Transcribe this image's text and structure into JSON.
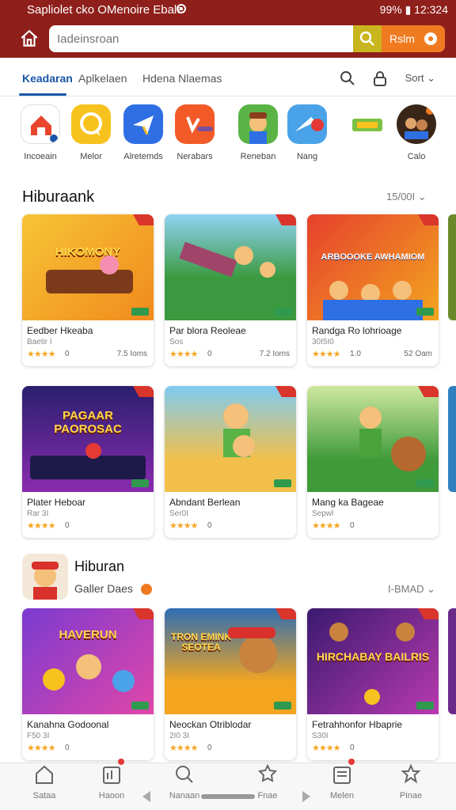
{
  "status_bar": {
    "app_name": "Sapliolet cko OMenoire Ebale",
    "right_text": "99% ▮ 12:324"
  },
  "search": {
    "placeholder": "Iadeinsroan",
    "cta_label": "Rslm"
  },
  "tabs": [
    {
      "label": "Keadaran",
      "active": true
    },
    {
      "label": "Aplkelaen",
      "active": false
    },
    {
      "label": "Hdena Nlaemas",
      "active": false
    }
  ],
  "sort_label": "Sort",
  "categories": [
    {
      "label": "Incoeain",
      "icon": "home-icon"
    },
    {
      "label": "Melor",
      "icon": "chat-bubble-icon"
    },
    {
      "label": "Alretemds",
      "icon": "paper-plane-icon"
    },
    {
      "label": "Nerabars",
      "icon": "music-app-icon"
    },
    {
      "label": "Reneban",
      "icon": "character-app-icon"
    },
    {
      "label": "Nang",
      "icon": "message-app-icon"
    },
    {
      "label": "",
      "icon": "logo-app-icon"
    },
    {
      "label": "Calo",
      "icon": "gaming-app-icon"
    }
  ],
  "section1": {
    "title": "Hiburaank",
    "more": "15/00I"
  },
  "section2": {
    "title": "Hiburan",
    "subtitle": "Galler Daes",
    "more": "I-BMAD"
  },
  "cards_row1": [
    {
      "art_title": "HIKOMONY",
      "name": "Eedber Hkeaba",
      "sub": "Baetir I",
      "stars": "★★★★",
      "rating": "0",
      "size": "7.5 Ioms",
      "art": "#f2a51e"
    },
    {
      "art_title": "",
      "name": "Par blora Reoleae",
      "sub": "Sos",
      "stars": "★★★★",
      "rating": "0",
      "size": "7.2 Ioms",
      "art": "#3b9a3f"
    },
    {
      "art_title": "ARBOOOKE AWHAMIOM",
      "name": "Randga Ro lohrioage",
      "sub": "30I5I0",
      "stars": "★★★★",
      "rating": "1.0",
      "size": "52 Oam",
      "art": "#d9302c"
    }
  ],
  "cards_row2": [
    {
      "art_title": "PAGAAR PAOROSAC",
      "name": "Plater Heboar",
      "sub": "Rar 3I",
      "stars": "★★★★",
      "rating": "0",
      "size": "",
      "art": "#3a2a78"
    },
    {
      "art_title": "",
      "name": "Abndant Berlean",
      "sub": "Ser0I",
      "stars": "★★★★",
      "rating": "0",
      "size": "",
      "art": "#4aa9d8"
    },
    {
      "art_title": "",
      "name": "Mang ka Bageae",
      "sub": "Sepwl",
      "stars": "★★★★",
      "rating": "0",
      "size": "",
      "art": "#66b84a"
    }
  ],
  "cards_row3": [
    {
      "art_title": "HAVERUN",
      "name": "Kanahna Godoonal",
      "sub": "F50 3I",
      "stars": "★★★★",
      "rating": "0",
      "size": "",
      "art": "#b93aa8"
    },
    {
      "art_title": "TRON EMINK SEOTEA",
      "name": "Neockan Otriblodar",
      "sub": "2I0 3I",
      "stars": "★★★★",
      "rating": "0",
      "size": "",
      "art": "#f0962a"
    },
    {
      "art_title": "HIRCHABAY BAILRIS",
      "name": "Fetrahhonfor Hbaprie",
      "sub": "S30I",
      "stars": "★★★★",
      "rating": "0",
      "size": "",
      "art": "#5a2a8a"
    }
  ],
  "bottom_nav": [
    {
      "label": "Sataa",
      "icon": "home-icon"
    },
    {
      "label": "Haoon",
      "icon": "calendar-icon"
    },
    {
      "label": "Nanaan",
      "icon": "search-icon"
    },
    {
      "label": "Fnae",
      "icon": "badge-icon"
    },
    {
      "label": "Melen",
      "icon": "news-icon"
    },
    {
      "label": "Pinae",
      "icon": "star-icon"
    }
  ]
}
